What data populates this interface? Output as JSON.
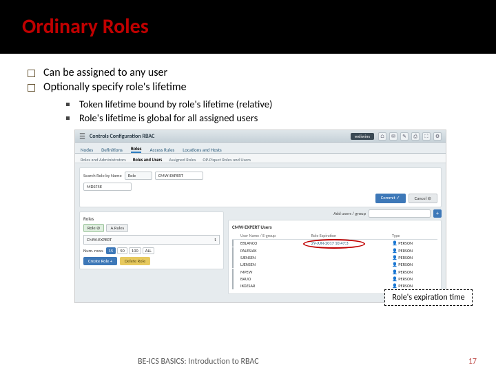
{
  "title": "Ordinary Roles",
  "bullets": [
    "Can be assigned to any user",
    "Optionally specify role's lifetime"
  ],
  "subbullets": [
    "Token lifetime bound by role's lifetime (relative)",
    "Role's lifetime is global for all assigned users"
  ],
  "screenshot": {
    "brand": "Controls Configuration RBAC",
    "user": "wsliwins",
    "icons": [
      "⌂",
      "✉",
      "✎",
      "⎙",
      "⛶",
      "⚙"
    ],
    "tabs1": [
      "Nodes",
      "Definitions",
      "Roles",
      "Access Rules",
      "Locations and Hosts"
    ],
    "tabs1_active": 2,
    "tabs2": [
      "Roles and Administrators",
      "Roles and Users",
      "Assigned Roles",
      "OP-Piquet Roles and Users"
    ],
    "tabs2_active": 1,
    "search": {
      "label": "Search Role by Name",
      "mode": "Role",
      "value": "CMW-EXPERT",
      "device": "MDSF5E"
    },
    "confirm": "Commit ✓",
    "cancel": "Cancel ⊘",
    "roles": {
      "heading": "Roles",
      "chip_role": "Role ⊘",
      "chip_all": "A.Rules",
      "item": "CMW-EXPERT",
      "item_count": "1",
      "numrows": "Num. rows",
      "pages": [
        "15",
        "50",
        "100",
        "ALL"
      ],
      "create": "Create Role +",
      "delete": "Delete Role"
    },
    "users": {
      "add_label": "Add users / group",
      "title": "CMW-EXPERT Users",
      "cols": [
        "",
        "User Name / E-group",
        "Role Expiration",
        "Type"
      ],
      "rows": [
        {
          "n": "EBLANCO",
          "e": "29-JUN-2017 10:47:3",
          "t": "PERSON"
        },
        {
          "n": "PALESIAK",
          "e": "",
          "t": "PERSON"
        },
        {
          "n": "SJENSEN",
          "e": "",
          "t": "PERSON"
        },
        {
          "n": "LJENSEN",
          "e": "",
          "t": "PERSON"
        },
        {
          "n": "MPEW",
          "e": "",
          "t": "PERSON"
        },
        {
          "n": "BAUO",
          "e": "",
          "t": "PERSON"
        },
        {
          "n": "IKOZSAR",
          "e": "",
          "t": "PERSON"
        }
      ]
    }
  },
  "callout": "Role's expiration time",
  "footer": "BE-ICS BASICS: Introduction to RBAC",
  "page": "17"
}
